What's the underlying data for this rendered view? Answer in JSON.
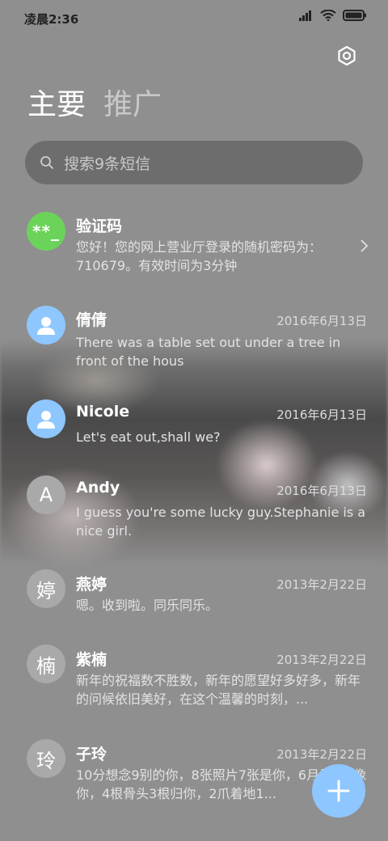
{
  "status_bar": {
    "time": "凌晨2:36"
  },
  "tabs": [
    {
      "label": "主要",
      "active": true
    },
    {
      "label": "推广",
      "active": false
    }
  ],
  "search": {
    "placeholder": "搜索9条短信"
  },
  "messages": [
    {
      "avatar": "**_",
      "name": "验证码",
      "date": "",
      "preview": "您好！您的网上营业厅登录的随机密码为：710679。有效时间为3分钟"
    },
    {
      "avatar": "",
      "name": "倩倩",
      "date": "2016年6月13日",
      "preview": "There was a table set out under a tree in front of the hous"
    },
    {
      "avatar": "",
      "name": "Nicole",
      "date": "2016年6月13日",
      "preview": "Let's eat out,shall we?"
    },
    {
      "avatar": "A",
      "name": "Andy",
      "date": "2016年6月13日",
      "preview": "I guess you're some lucky guy.Stephanie is a nice girl."
    },
    {
      "avatar": "婷",
      "name": "燕婷",
      "date": "2013年2月22日",
      "preview": "嗯。收到啦。同乐同乐。"
    },
    {
      "avatar": "楠",
      "name": "紫楠",
      "date": "2013年2月22日",
      "preview": "新年的祝福数不胜数，新年的愿望好多好多，新年的问候依旧美好，在这个温馨的时刻，..."
    },
    {
      "avatar": "玲",
      "name": "子玲",
      "date": "2013年2月22日",
      "preview": "10分想念9别的你，8张照片7张是你，6月里5只像你，4根骨头3根归你，2爪着地1..."
    }
  ],
  "colors": {
    "accent": "#8ec6ff",
    "code_avatar": "#6bd35a",
    "background": "#8f8f8f"
  }
}
